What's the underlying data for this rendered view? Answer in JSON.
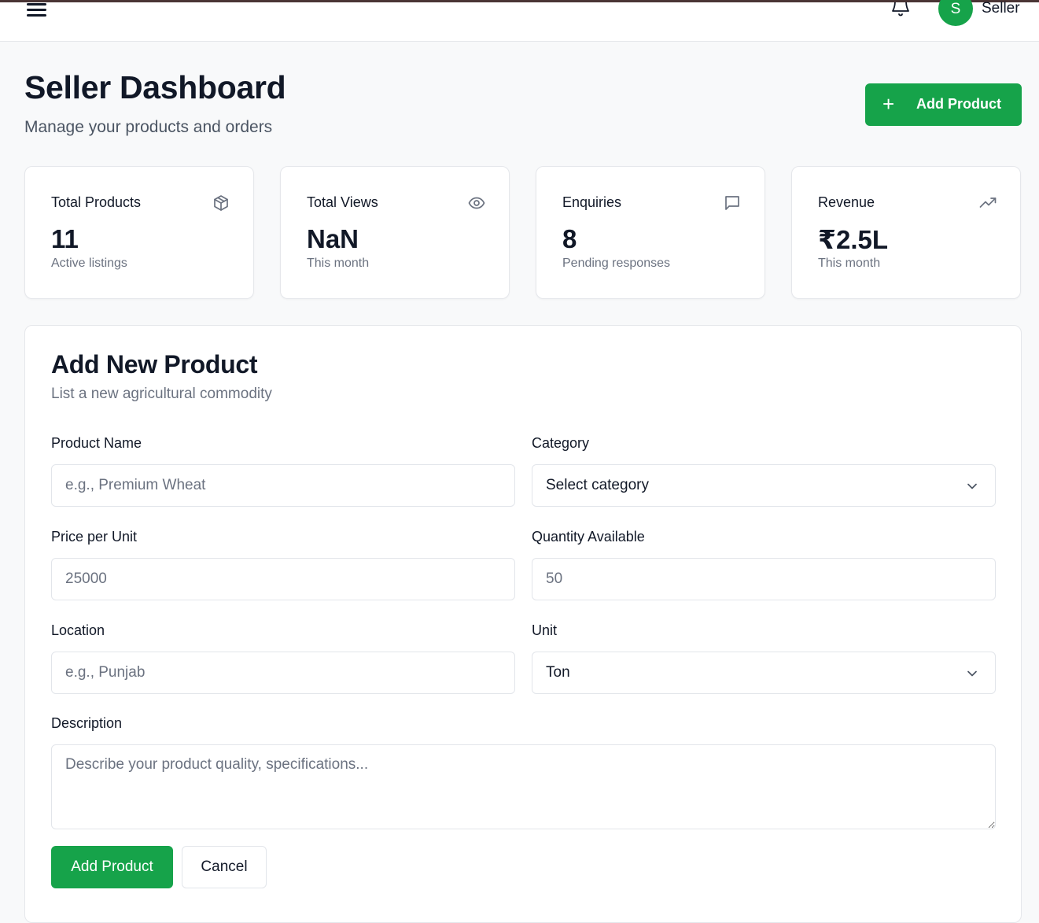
{
  "header": {
    "user_initial": "S",
    "user_name": "Seller"
  },
  "page": {
    "title": "Seller Dashboard",
    "subtitle": "Manage your products and orders",
    "add_button_label": "Add Product"
  },
  "stats": [
    {
      "label": "Total Products",
      "value": "11",
      "note": "Active listings",
      "icon": "package-icon"
    },
    {
      "label": "Total Views",
      "value": "NaN",
      "note": "This month",
      "icon": "eye-icon"
    },
    {
      "label": "Enquiries",
      "value": "8",
      "note": "Pending responses",
      "icon": "message-icon"
    },
    {
      "label": "Revenue",
      "value": "₹2.5L",
      "note": "This month",
      "icon": "trending-up-icon"
    }
  ],
  "form": {
    "title": "Add New Product",
    "subtitle": "List a new agricultural commodity",
    "product_name_label": "Product Name",
    "product_name_placeholder": "e.g., Premium Wheat",
    "category_label": "Category",
    "category_value": "Select category",
    "price_label": "Price per Unit",
    "price_placeholder": "25000",
    "quantity_label": "Quantity Available",
    "quantity_placeholder": "50",
    "location_label": "Location",
    "location_placeholder": "e.g., Punjab",
    "unit_label": "Unit",
    "unit_value": "Ton",
    "description_label": "Description",
    "description_placeholder": "Describe your product quality, specifications...",
    "submit_label": "Add Product",
    "cancel_label": "Cancel"
  },
  "colors": {
    "accent": "#16a34a",
    "text": "#111827",
    "muted": "#6b7280",
    "background": "#f8f9fa"
  }
}
